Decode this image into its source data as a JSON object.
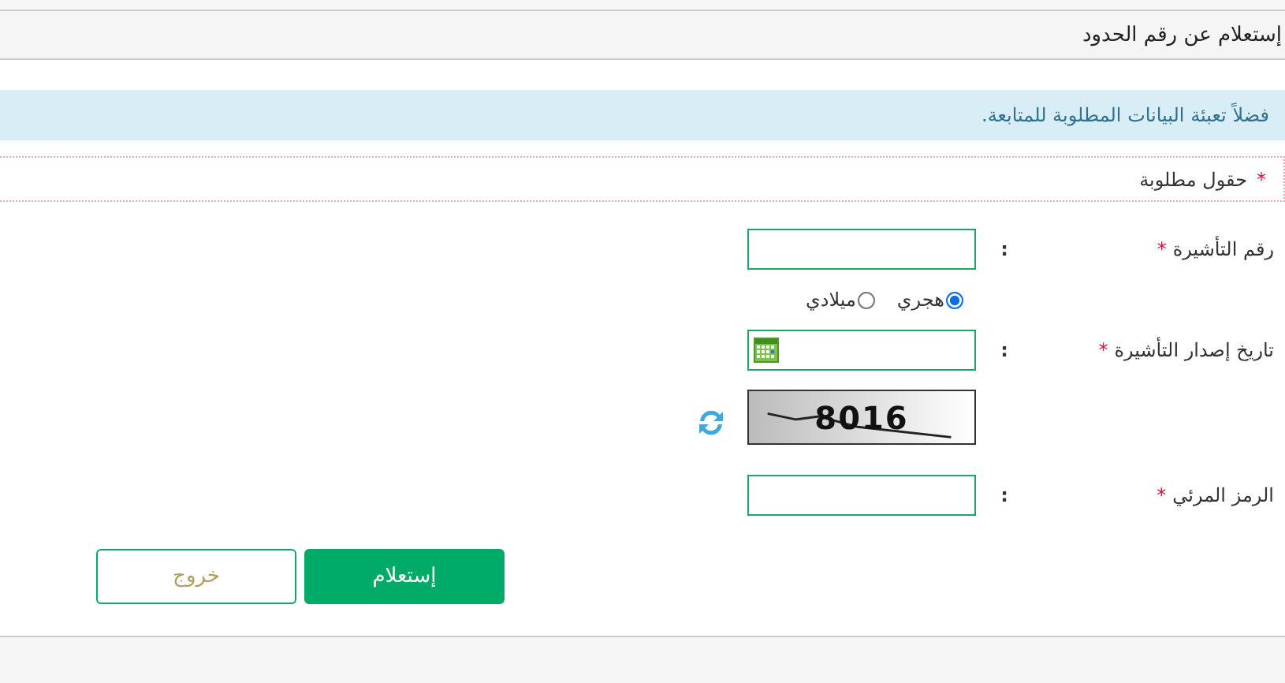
{
  "header": {
    "title": "إستعلام عن رقم الحدود"
  },
  "notice": "فضلاً تعبئة البيانات المطلوبة للمتابعة.",
  "required_note": {
    "marker": "*",
    "text": "حقول مطلوبة"
  },
  "fields": [
    {
      "kind": "text",
      "label": "رقم التأشيرة",
      "required_mark": "*",
      "colon": ":"
    },
    {
      "kind": "radios",
      "options": [
        {
          "label": "هجري",
          "selected": true
        },
        {
          "label": "ميلادي",
          "selected": false
        }
      ]
    },
    {
      "kind": "date",
      "label": "تاريخ إصدار التأشيرة",
      "required_mark": "*",
      "colon": ":"
    },
    {
      "kind": "captcha",
      "code": "8016"
    },
    {
      "kind": "text",
      "label": "الرمز المرئي",
      "required_mark": "*",
      "colon": ":"
    }
  ],
  "buttons": [
    {
      "kind": "primary",
      "label": "إستعلام"
    },
    {
      "kind": "secondary",
      "label": "خروج"
    }
  ]
}
